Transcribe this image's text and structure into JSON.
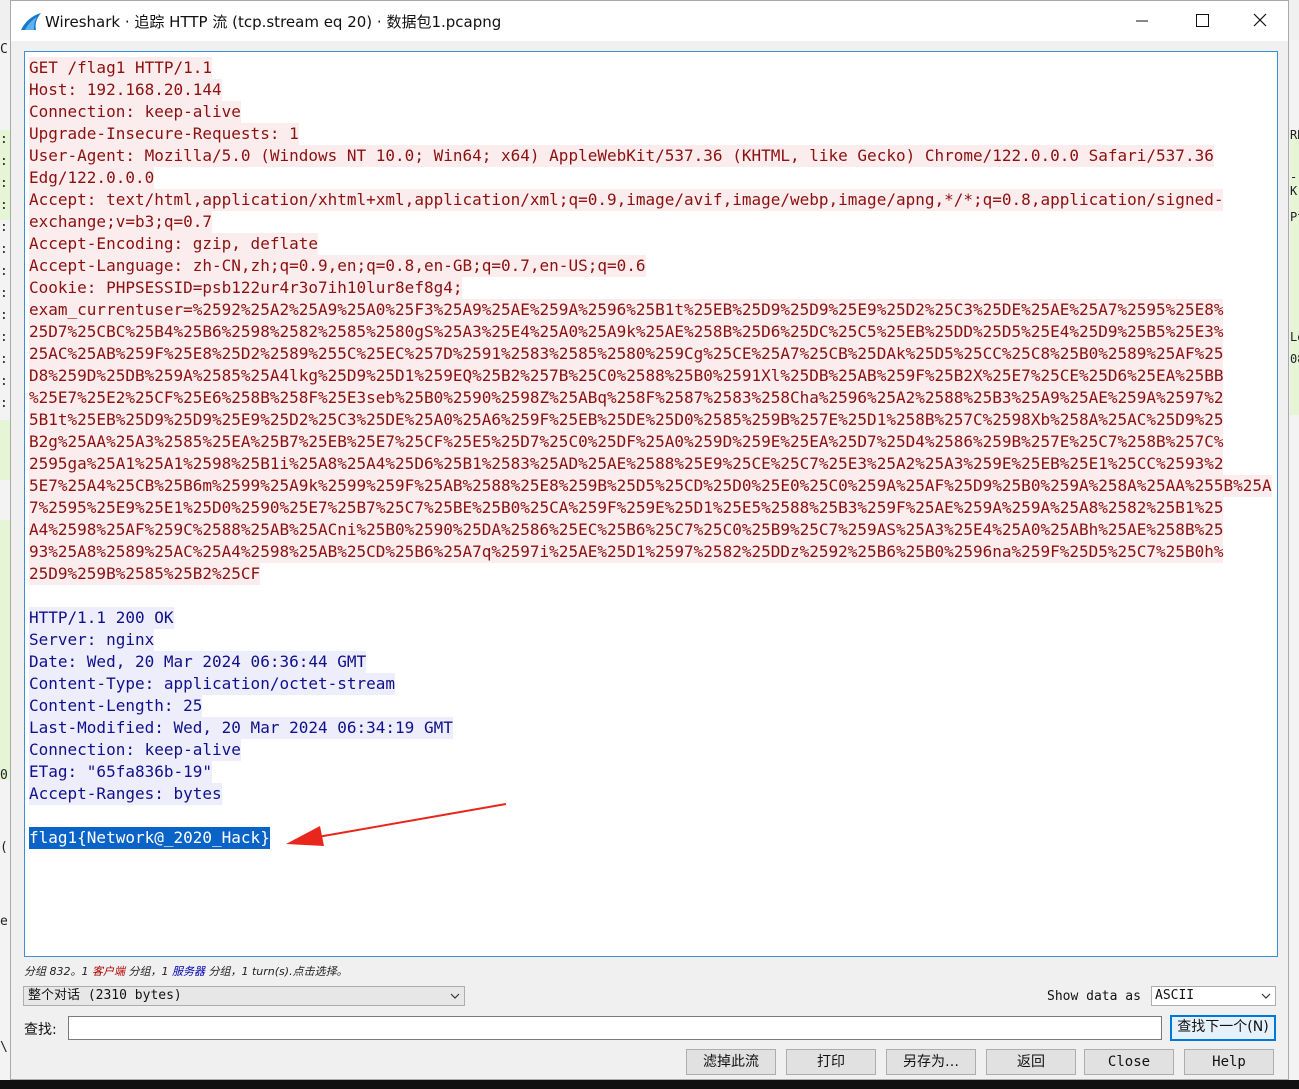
{
  "window": {
    "title": "Wireshark · 追踪 HTTP 流 (tcp.stream eq 20) · 数据包1.pcapng"
  },
  "stream": {
    "client_lines": [
      "GET /flag1 HTTP/1.1",
      "Host: 192.168.20.144",
      "Connection: keep-alive",
      "Upgrade-Insecure-Requests: 1",
      "User-Agent: Mozilla/5.0 (Windows NT 10.0; Win64; x64) AppleWebKit/537.36 (KHTML, like Gecko) Chrome/122.0.0.0 Safari/537.36",
      "Edg/122.0.0.0",
      "Accept: text/html,application/xhtml+xml,application/xml;q=0.9,image/avif,image/webp,image/apng,*/*;q=0.8,application/signed-",
      "exchange;v=b3;q=0.7",
      "Accept-Encoding: gzip, deflate",
      "Accept-Language: zh-CN,zh;q=0.9,en;q=0.8,en-GB;q=0.7,en-US;q=0.6",
      "Cookie: PHPSESSID=psb122ur4r3o7ih10lur8ef8g4;",
      "exam_currentuser=%2592%25A2%25A9%25A0%25F3%25A9%25AE%259A%2596%25B1t%25EB%25D9%25D9%25E9%25D2%25C3%25DE%25AE%25A7%2595%25E8%",
      "25D7%25CBC%25B4%25B6%2598%2582%2585%2580gS%25A3%25E4%25A0%25A9k%25AE%258B%25D6%25DC%25C5%25EB%25DD%25D5%25E4%25D9%25B5%25E3%",
      "25AC%25AB%259F%25E8%25D2%2589%255C%25EC%257D%2591%2583%2585%2580%259Cg%25CE%25A7%25CB%25DAk%25D5%25CC%25C8%25B0%2589%25AF%25",
      "D8%259D%25DB%259A%2585%25A4lkg%25D9%25D1%259EQ%25B2%257B%25C0%2588%25B0%2591Xl%25DB%25AB%259F%25B2X%25E7%25CE%25D6%25EA%25BB",
      "%25E7%25E2%25CF%25E6%258B%258F%25E3seb%25B0%2590%2598Z%25ABq%258F%2587%2583%258Cha%2596%25A2%2588%25B3%25A9%25AE%259A%2597%2",
      "5B1t%25EB%25D9%25D9%25E9%25D2%25C3%25DE%25A0%25A6%259F%25EB%25DE%25D0%2585%259B%257E%25D1%258B%257C%2598Xb%258A%25AC%25D9%25",
      "B2g%25AA%25A3%2585%25EA%25B7%25EB%25E7%25CF%25E5%25D7%25C0%25DF%25A0%259D%259E%25EA%25D7%25D4%2586%259B%257E%25C7%258B%257C%",
      "2595ga%25A1%25A1%2598%25B1i%25A8%25A4%25D6%25B1%2583%25AD%25AE%2588%25E9%25CE%25C7%25E3%25A2%25A3%259E%25EB%25E1%25CC%2593%2",
      "5E7%25A4%25CB%25B6m%2599%25A9k%2599%259F%25AB%2588%25E8%259B%25D5%25CD%25D0%25E0%25C0%259A%25AF%25D9%25B0%259A%258A%25AA%255B%25A",
      "7%2595%25E9%25E1%25D0%2590%25E7%25B7%25C7%25BE%25B0%25CA%259F%259E%25D1%25E5%2588%25B3%259F%25AE%259A%259A%25A8%2582%25B1%25",
      "A4%2598%25AF%259C%2588%25AB%25ACni%25B0%2590%25DA%2586%25EC%25B6%25C7%25C0%25B9%25C7%259AS%25A3%25E4%25A0%25ABh%25AE%258B%25",
      "93%25A8%2589%25AC%25A4%2598%25AB%25CD%25B6%25A7q%2597i%25AE%25D1%2597%2582%25DDz%2592%25B6%25B0%2596na%259F%25D5%25C7%25B0h%",
      "25D9%259B%2585%25B2%25CF"
    ],
    "server_lines": [
      "HTTP/1.1 200 OK",
      "Server: nginx",
      "Date: Wed, 20 Mar 2024 06:36:44 GMT",
      "Content-Type: application/octet-stream",
      "Content-Length: 25",
      "Last-Modified: Wed, 20 Mar 2024 06:34:19 GMT",
      "Connection: keep-alive",
      "ETag: \"65fa836b-19\"",
      "Accept-Ranges: bytes"
    ],
    "body_line": "flag1{Network@_2020_Hack}"
  },
  "stats": {
    "part1": "分组 832。1 ",
    "client_word": "客户端",
    "part2": " 分组，1 ",
    "server_word": "服务器",
    "part3": " 分组，1 turn(s).点击选择。"
  },
  "controls": {
    "conversation_select": "整个对话 (2310 bytes)",
    "show_data_label": "Show data as",
    "show_data_value": "ASCII",
    "find_label": "查找:",
    "find_value": "",
    "find_next_label": "查找下一个(N)"
  },
  "buttons": {
    "filter_out": "滤掉此流",
    "print": "打印",
    "save_as": "另存为…",
    "back": "返回",
    "close": "Close",
    "help": "Help"
  },
  "background_fragments": {
    "left": [
      "C",
      ":",
      ":",
      ":",
      ":",
      ":",
      ":",
      ":",
      ":",
      ":",
      ":",
      ":",
      ":",
      ":",
      "0",
      "(",
      "e",
      "\\"
    ],
    "right": [
      "RN",
      "-K",
      "Pt",
      "Le",
      "08"
    ]
  },
  "colors": {
    "client_text": "#8c1010",
    "client_bg": "#fbeded",
    "server_text": "#10108c",
    "server_bg": "#ededfb",
    "selection_bg": "#0a64c8",
    "arrow": "#e8261c"
  }
}
